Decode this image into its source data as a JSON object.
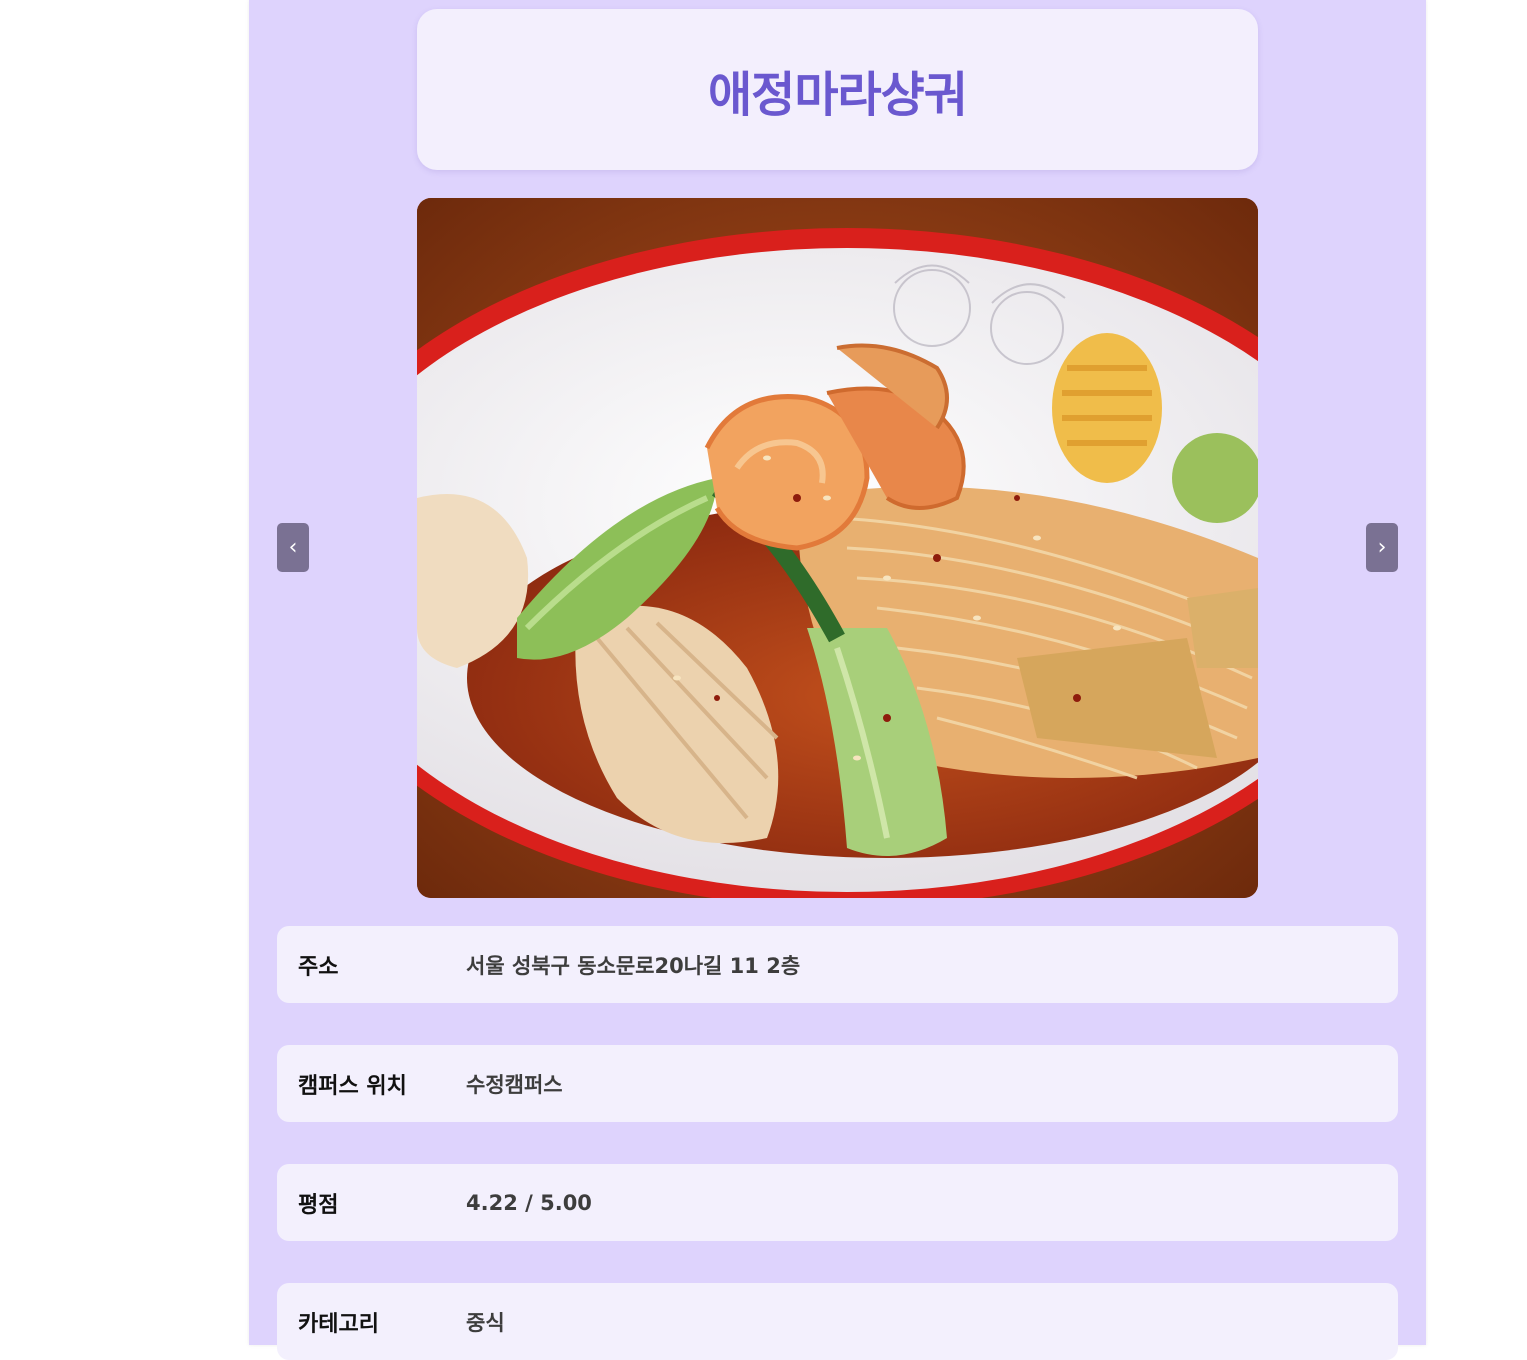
{
  "restaurant": {
    "name": "애정마라샹궈"
  },
  "carousel": {
    "prev_label": "‹",
    "next_label": "›",
    "image_alt": "mala xiang guo dish with shrimp, bok choy and enoki mushrooms"
  },
  "details": [
    {
      "label": "주소",
      "value": "서울 성북구 동소문로20나길 11 2층"
    },
    {
      "label": "캠퍼스 위치",
      "value": "수정캠퍼스"
    },
    {
      "label": "평점",
      "value": "4.22 / 5.00"
    },
    {
      "label": "카테고리",
      "value": "중식"
    }
  ],
  "colors": {
    "page_bg": "#ded3fd",
    "card_bg": "#f3effd",
    "title": "#6a58cf",
    "nav_button": "#7a7193"
  }
}
